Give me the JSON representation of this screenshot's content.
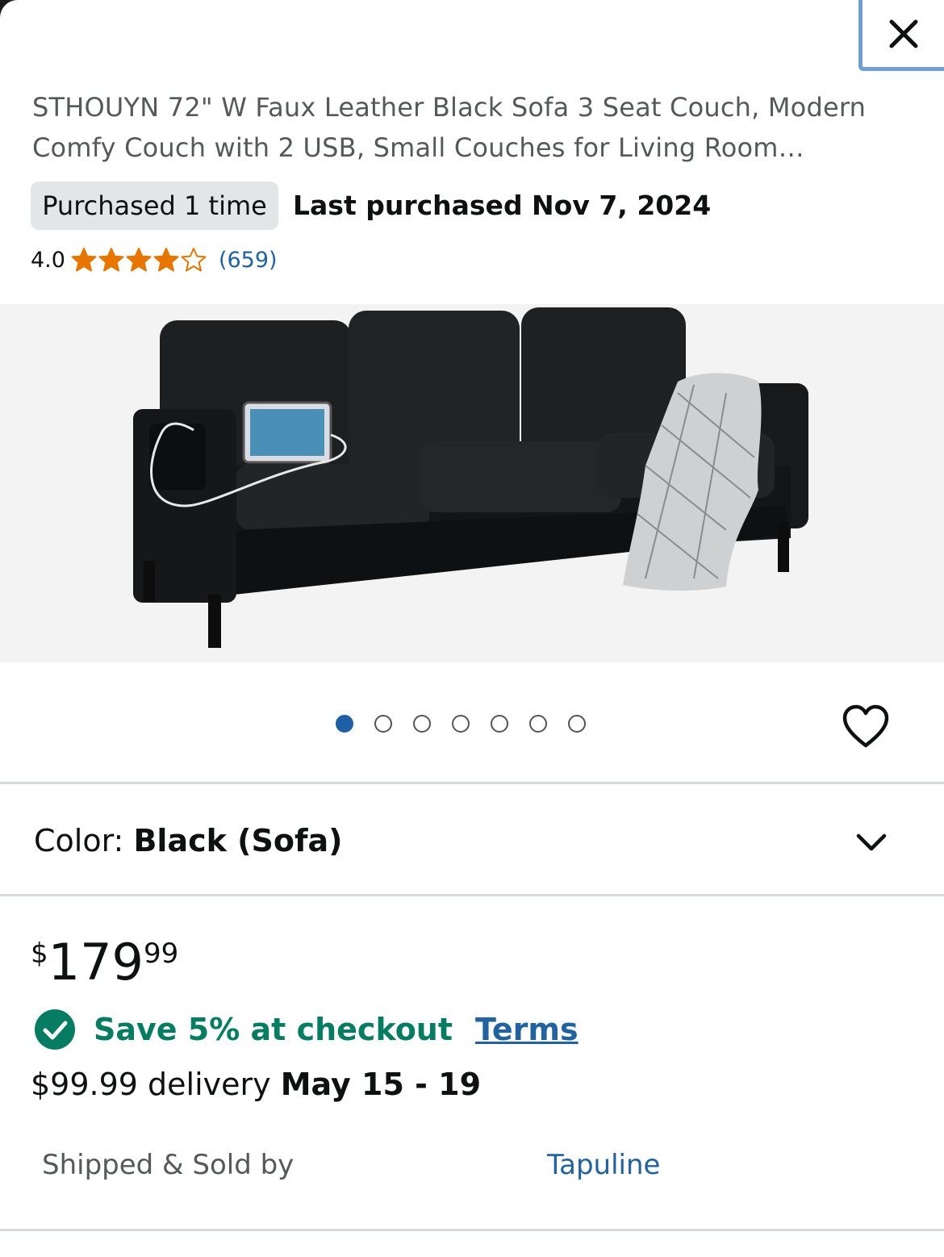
{
  "product": {
    "title_line1": "STHOUYN 72\" W Faux Leather Black Sofa 3 Seat Couch, Modern",
    "title_line2": "Comfy Couch with 2 USB, Small Couches for Living Room…",
    "purchased_badge": "Purchased 1 time",
    "last_purchased": "Last purchased Nov 7, 2024",
    "rating_value": "4.0",
    "rating_stars": 4,
    "rating_max": 5,
    "review_count": "(659)"
  },
  "gallery": {
    "image_count": 7,
    "active_index": 0
  },
  "variant": {
    "color_label": "Color:",
    "color_value": "Black (Sofa)"
  },
  "pricing": {
    "currency_symbol": "$",
    "price_whole": "179",
    "price_fraction": "99",
    "save_text": "Save 5% at checkout",
    "terms_link": "Terms",
    "delivery_price": "$99.99 delivery",
    "delivery_dates": "May 15 - 19"
  },
  "seller": {
    "label": "Shipped & Sold by",
    "name": "Tapuline"
  },
  "colors": {
    "star": "#e77600",
    "link": "#2162a1",
    "success": "#067d62",
    "dot_active": "#1f5fa6"
  },
  "icons": {
    "close": "close-icon",
    "heart": "heart-icon",
    "chevron": "chevron-down-icon",
    "check": "check-circle-icon"
  }
}
